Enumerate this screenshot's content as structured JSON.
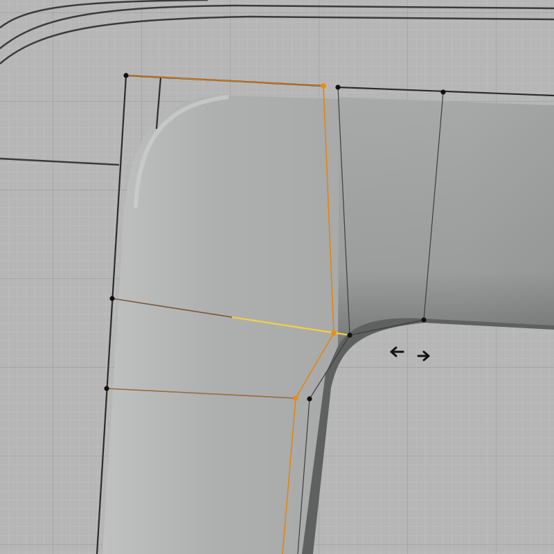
{
  "viewport": {
    "label": "",
    "colors": {
      "background": "#b4b4b4",
      "grid_minor": "#c2c2c2",
      "grid_major": "#9e9e9e",
      "mesh_fill": "#a9aaaa",
      "mesh_shadow": "#5e5e5e",
      "cage_edge": "#2a2a2a",
      "wire_unselected": "#3c3c3c",
      "wire_selected": "#e2860f",
      "edge_active": "#f0d040",
      "vertex_unselected": "#111111",
      "vertex_selected": "#f08a10"
    },
    "overlays": {
      "cursor_icon": "horizontal-resize-arrows-icon",
      "grid": true,
      "wireframe_overlay": true
    }
  }
}
